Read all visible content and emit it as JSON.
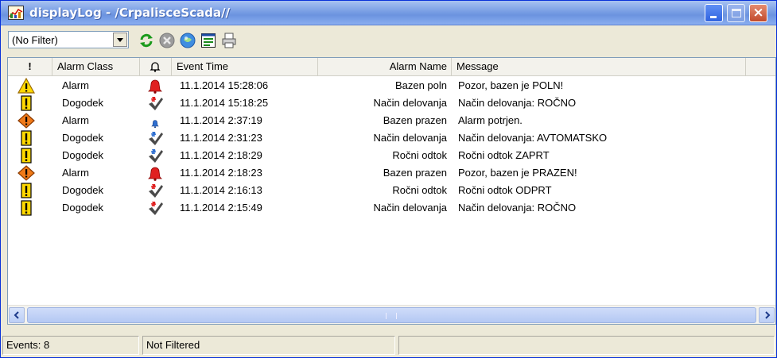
{
  "window": {
    "title": "displayLog - /CrpalisceScada//",
    "controls": {
      "minimize": "minimize",
      "maximize": "maximize",
      "close": "×"
    }
  },
  "toolbar": {
    "filter": {
      "selected": "(No Filter)"
    },
    "icons": [
      "refresh-icon",
      "stop-icon",
      "acknowledge-icon",
      "properties-icon",
      "print-icon"
    ]
  },
  "list": {
    "columns": {
      "priority": "!",
      "alarm_class": "Alarm Class",
      "state": "bell-icon",
      "event_time": "Event Time",
      "alarm_name": "Alarm Name",
      "message": "Message"
    },
    "rows": [
      {
        "icon": "warning-triangle",
        "state": "bell-red",
        "alarm_class": "Alarm",
        "event_time": "11.1.2014 15:28:06",
        "alarm_name": "Bazen poln",
        "message": "Pozor, bazen je POLN!"
      },
      {
        "icon": "event-exclamation",
        "state": "check-red",
        "alarm_class": "Dogodek",
        "event_time": "11.1.2014 15:18:25",
        "alarm_name": "Način delovanja",
        "message": "Način delovanja: ROČNO"
      },
      {
        "icon": "warning-diamond",
        "state": "bell-blue-small",
        "alarm_class": "Alarm",
        "event_time": "11.1.2014 2:37:19",
        "alarm_name": "Bazen prazen",
        "message": "Alarm potrjen."
      },
      {
        "icon": "event-exclamation",
        "state": "check-blue",
        "alarm_class": "Dogodek",
        "event_time": "11.1.2014 2:31:23",
        "alarm_name": "Način delovanja",
        "message": "Način delovanja: AVTOMATSKO"
      },
      {
        "icon": "event-exclamation",
        "state": "check-blue",
        "alarm_class": "Dogodek",
        "event_time": "11.1.2014 2:18:29",
        "alarm_name": "Ročni odtok",
        "message": "Ročni odtok ZAPRT"
      },
      {
        "icon": "warning-diamond",
        "state": "bell-red",
        "alarm_class": "Alarm",
        "event_time": "11.1.2014 2:18:23",
        "alarm_name": "Bazen prazen",
        "message": "Pozor, bazen je PRAZEN!"
      },
      {
        "icon": "event-exclamation",
        "state": "check-red",
        "alarm_class": "Dogodek",
        "event_time": "11.1.2014 2:16:13",
        "alarm_name": "Ročni odtok",
        "message": "Ročni odtok ODPRT"
      },
      {
        "icon": "event-exclamation",
        "state": "check-red",
        "alarm_class": "Dogodek",
        "event_time": "11.1.2014 2:15:49",
        "alarm_name": "Način delovanja",
        "message": "Način delovanja: ROČNO"
      }
    ]
  },
  "status": {
    "events": "Events: 8",
    "filter_state": "Not Filtered",
    "extra": ""
  },
  "colors": {
    "title_bar": "#7ea2e6",
    "alarm_red": "#e02020",
    "ack_blue": "#2f6fd0",
    "warning_yellow": "#ffd800",
    "diamond_orange": "#f07a18"
  }
}
